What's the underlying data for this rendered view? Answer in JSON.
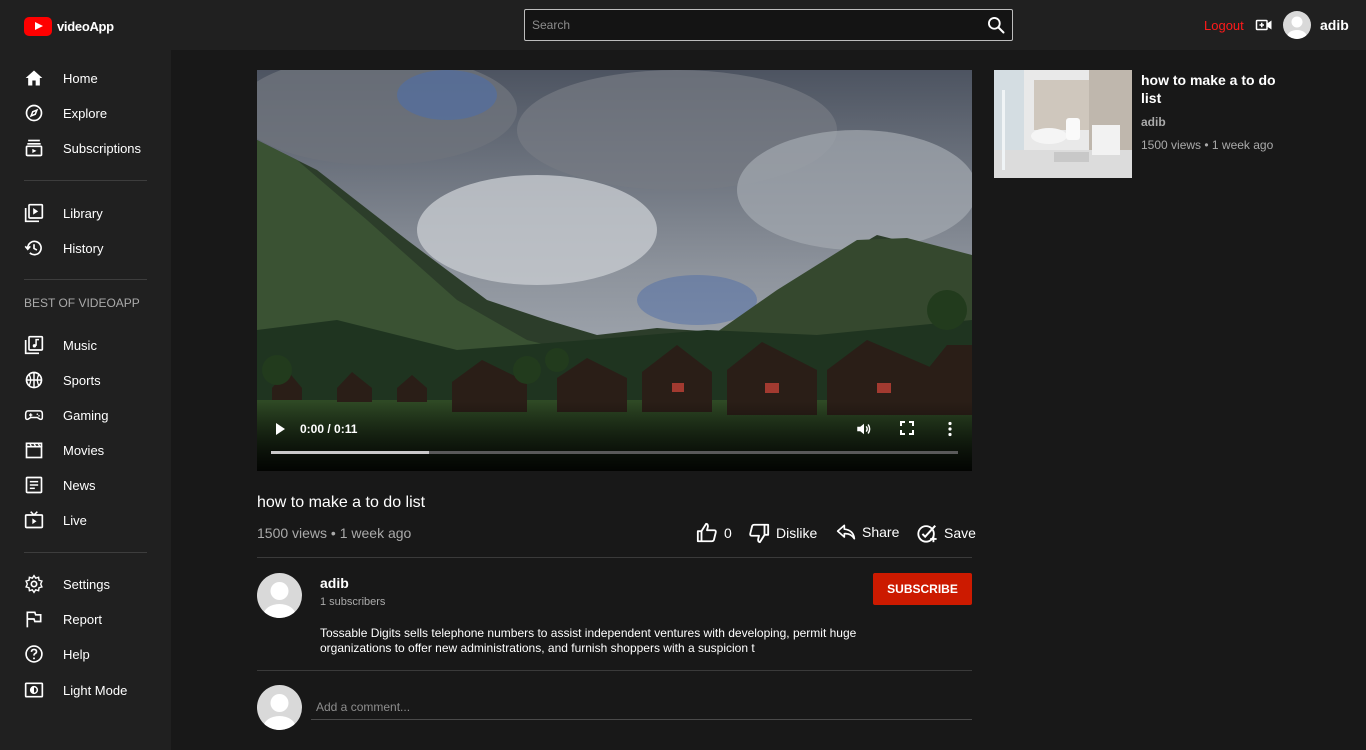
{
  "header": {
    "logo_text": "videoApp",
    "search_placeholder": "Search",
    "logout_label": "Logout",
    "username": "adib"
  },
  "sidebar": {
    "group1": [
      {
        "label": "Home",
        "icon": "home-icon"
      },
      {
        "label": "Explore",
        "icon": "compass-icon"
      },
      {
        "label": "Subscriptions",
        "icon": "subscriptions-icon"
      }
    ],
    "group2": [
      {
        "label": "Library",
        "icon": "library-icon"
      },
      {
        "label": "History",
        "icon": "history-icon"
      }
    ],
    "section_title": "BEST OF VIDEOAPP",
    "group3": [
      {
        "label": "Music",
        "icon": "music-icon"
      },
      {
        "label": "Sports",
        "icon": "sports-icon"
      },
      {
        "label": "Gaming",
        "icon": "gaming-icon"
      },
      {
        "label": "Movies",
        "icon": "movies-icon"
      },
      {
        "label": "News",
        "icon": "news-icon"
      },
      {
        "label": "Live",
        "icon": "live-icon"
      }
    ],
    "group4": [
      {
        "label": "Settings",
        "icon": "settings-icon"
      },
      {
        "label": "Report",
        "icon": "flag-icon"
      },
      {
        "label": "Help",
        "icon": "help-icon"
      },
      {
        "label": "Light Mode",
        "icon": "light-mode-icon"
      }
    ]
  },
  "player": {
    "time": "0:00 / 0:11",
    "progress": 0.23
  },
  "video": {
    "title": "how to make a to do list",
    "meta": "1500 views • 1 week ago",
    "likes": "0",
    "dislike_label": "Dislike",
    "share_label": "Share",
    "save_label": "Save"
  },
  "channel": {
    "name": "adib",
    "subscribers": "1 subscribers",
    "subscribe_label": "SUBSCRIBE",
    "description": "Tossable Digits sells telephone numbers to assist independent ventures with developing, permit huge organizations to offer new administrations, and furnish shoppers with a suspicion t"
  },
  "comments": {
    "placeholder": "Add a comment..."
  },
  "related": [
    {
      "title": "how to make a to do list",
      "channel": "adib",
      "meta": "1500 views • 1 week ago"
    }
  ],
  "colors": {
    "accent_red": "#ff0000",
    "logout_red": "#ff1a1a",
    "subscribe_red": "#cc1a00",
    "sidebar_bg": "#202020",
    "page_bg": "#181818"
  }
}
